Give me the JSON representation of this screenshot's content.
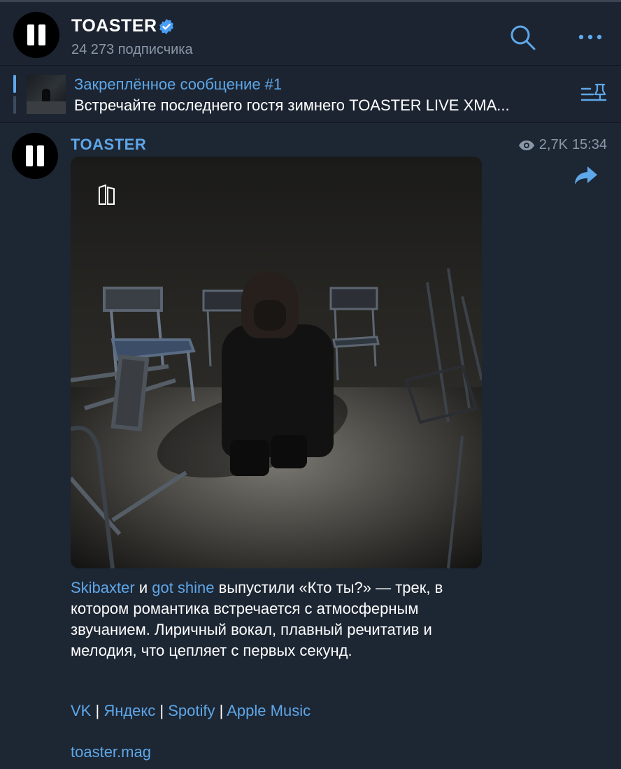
{
  "header": {
    "channel_name": "TOASTER",
    "subscribers": "24 273 подписчика"
  },
  "pinned": {
    "title": "Закреплённое сообщение #1",
    "text": "Встречайте последнего гостя зимнего TOASTER LIVE XMA..."
  },
  "post": {
    "author": "TOASTER",
    "views": "2,7K",
    "time": "15:34",
    "text": {
      "mention1": "Skibaxter",
      "and": " и ",
      "mention2": "got shine",
      "body": " выпустили «Кто ты?» — трек, в котором романтика встречается с атмосферным звучанием. Лиричный вокал, плавный речитатив и мелодия, что цепляет с первых секунд."
    },
    "links": [
      {
        "label": "VK"
      },
      {
        "label": "Яндекс"
      },
      {
        "label": "Spotify"
      },
      {
        "label": "Apple Music"
      }
    ],
    "separator": " | ",
    "mag_link": "toaster.mag"
  },
  "colors": {
    "background": "#1d2633",
    "accent": "#5ea7e8",
    "muted": "#8a97a8"
  },
  "icons": [
    "toaster-logo-icon",
    "verified-icon",
    "search-icon",
    "more-icon",
    "pin-list-icon",
    "eye-icon",
    "share-icon"
  ]
}
